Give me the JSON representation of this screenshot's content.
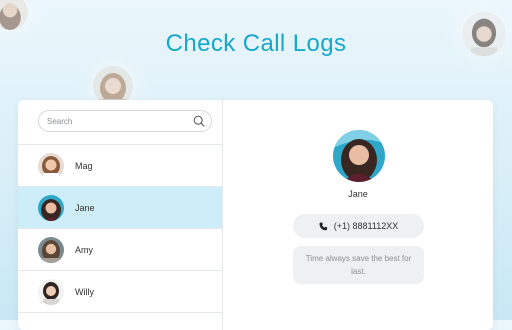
{
  "headline": "Check Call Logs",
  "search": {
    "placeholder": "Search",
    "icon": "search-icon"
  },
  "contacts": [
    {
      "name": "Mag",
      "selected": false
    },
    {
      "name": "Jane",
      "selected": true
    },
    {
      "name": "Amy",
      "selected": false
    },
    {
      "name": "Willy",
      "selected": false
    }
  ],
  "detail": {
    "name": "Jane",
    "phone": "(+1)  8881112XX",
    "phone_icon": "phone-icon",
    "note": "Time always save the best for last."
  },
  "colors": {
    "accent": "#15a8cb",
    "selected_row": "#cdeef8",
    "pill": "#eef0f1"
  }
}
